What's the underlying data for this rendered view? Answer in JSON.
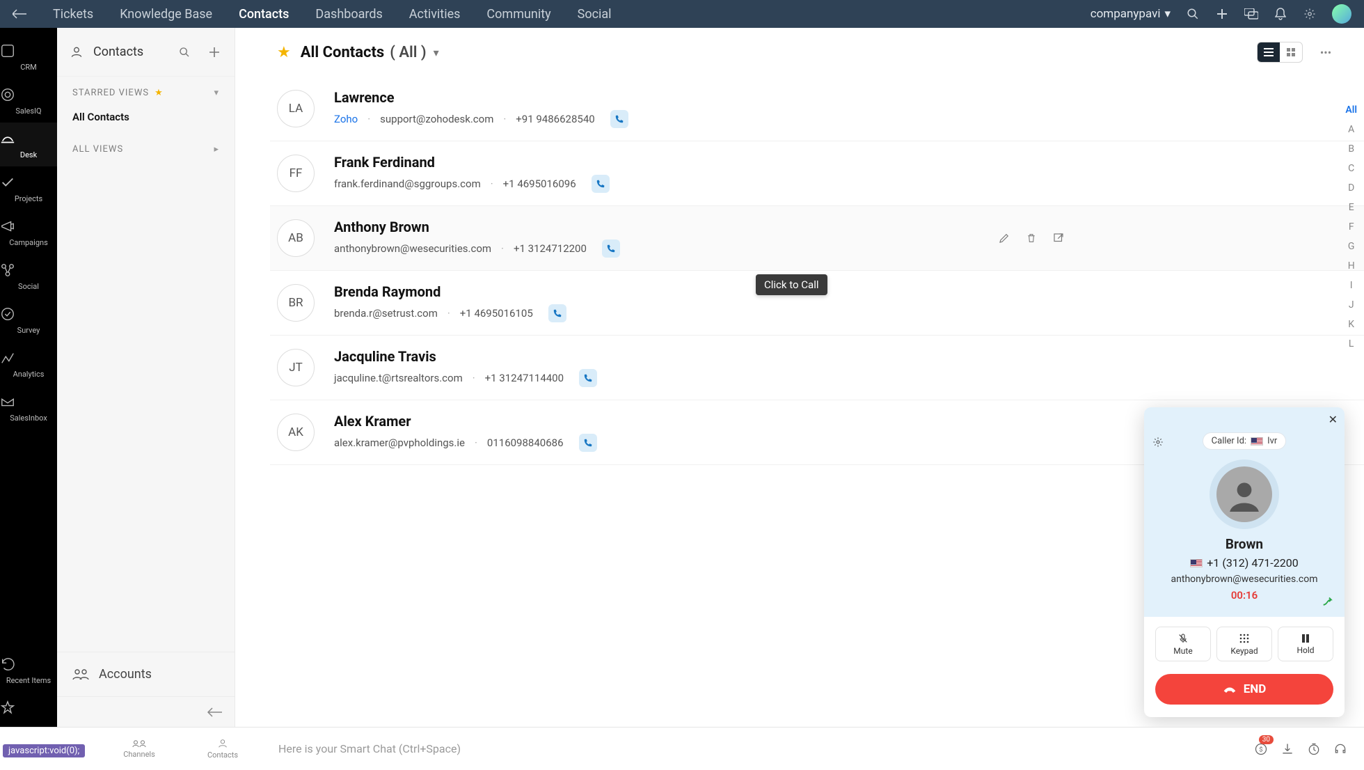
{
  "topnav": {
    "tabs": [
      "Tickets",
      "Knowledge Base",
      "Contacts",
      "Dashboards",
      "Activities",
      "Community",
      "Social"
    ],
    "active_index": 2,
    "org": "companypavi"
  },
  "apprail": [
    {
      "label": "CRM"
    },
    {
      "label": "SalesIQ"
    },
    {
      "label": "Desk",
      "active": true
    },
    {
      "label": "Projects"
    },
    {
      "label": "Campaigns"
    },
    {
      "label": "Social"
    },
    {
      "label": "Survey"
    },
    {
      "label": "Analytics"
    },
    {
      "label": "SalesInbox"
    }
  ],
  "apprail_bottom": [
    {
      "label": "Recent Items"
    },
    {
      "label": ""
    }
  ],
  "sidebar": {
    "section_title": "Contacts",
    "starred_header": "STARRED VIEWS",
    "starred_views": [
      "All Contacts"
    ],
    "all_views_header": "ALL VIEWS",
    "accounts_label": "Accounts"
  },
  "main": {
    "title": "All Contacts",
    "count_label": "( All )",
    "contacts": [
      {
        "initials": "LA",
        "name": "Lawrence",
        "org": "Zoho",
        "email": "support@zohodesk.com",
        "phone": "+91 9486628540"
      },
      {
        "initials": "FF",
        "name": "Frank Ferdinand",
        "org": "",
        "email": "frank.ferdinand@sggroups.com",
        "phone": "+1 4695016096"
      },
      {
        "initials": "AB",
        "name": "Anthony Brown",
        "org": "",
        "email": "anthonybrown@wesecurities.com",
        "phone": "+1 3124712200",
        "hovered": true
      },
      {
        "initials": "BR",
        "name": "Brenda Raymond",
        "org": "",
        "email": "brenda.r@setrust.com",
        "phone": "+1 4695016105"
      },
      {
        "initials": "JT",
        "name": "Jacquline Travis",
        "org": "",
        "email": "jacquline.t@rtsrealtors.com",
        "phone": "+1 31247114400"
      },
      {
        "initials": "AK",
        "name": "Alex Kramer",
        "org": "",
        "email": "alex.kramer@pvpholdings.ie",
        "phone": "0116098840686"
      }
    ],
    "tooltip_text": "Click to Call",
    "alpha_active": "All",
    "alpha": [
      "All",
      "A",
      "B",
      "C",
      "D",
      "E",
      "F",
      "G",
      "H",
      "I",
      "J",
      "K",
      "L"
    ]
  },
  "call": {
    "caller_id_label": "Caller Id:",
    "caller_id_value": "Ivr",
    "name": "Brown",
    "phone": "+1 (312) 471-2200",
    "email": "anthonybrown@wesecurities.com",
    "timer": "00:16",
    "mute": "Mute",
    "keypad": "Keypad",
    "hold": "Hold",
    "end": "END"
  },
  "bottombar": {
    "jsvoid": "javascript:void(0);",
    "channels": "Channels",
    "contacts": "Contacts",
    "smartchat_placeholder": "Here is your Smart Chat (Ctrl+Space)",
    "badge": "30"
  }
}
